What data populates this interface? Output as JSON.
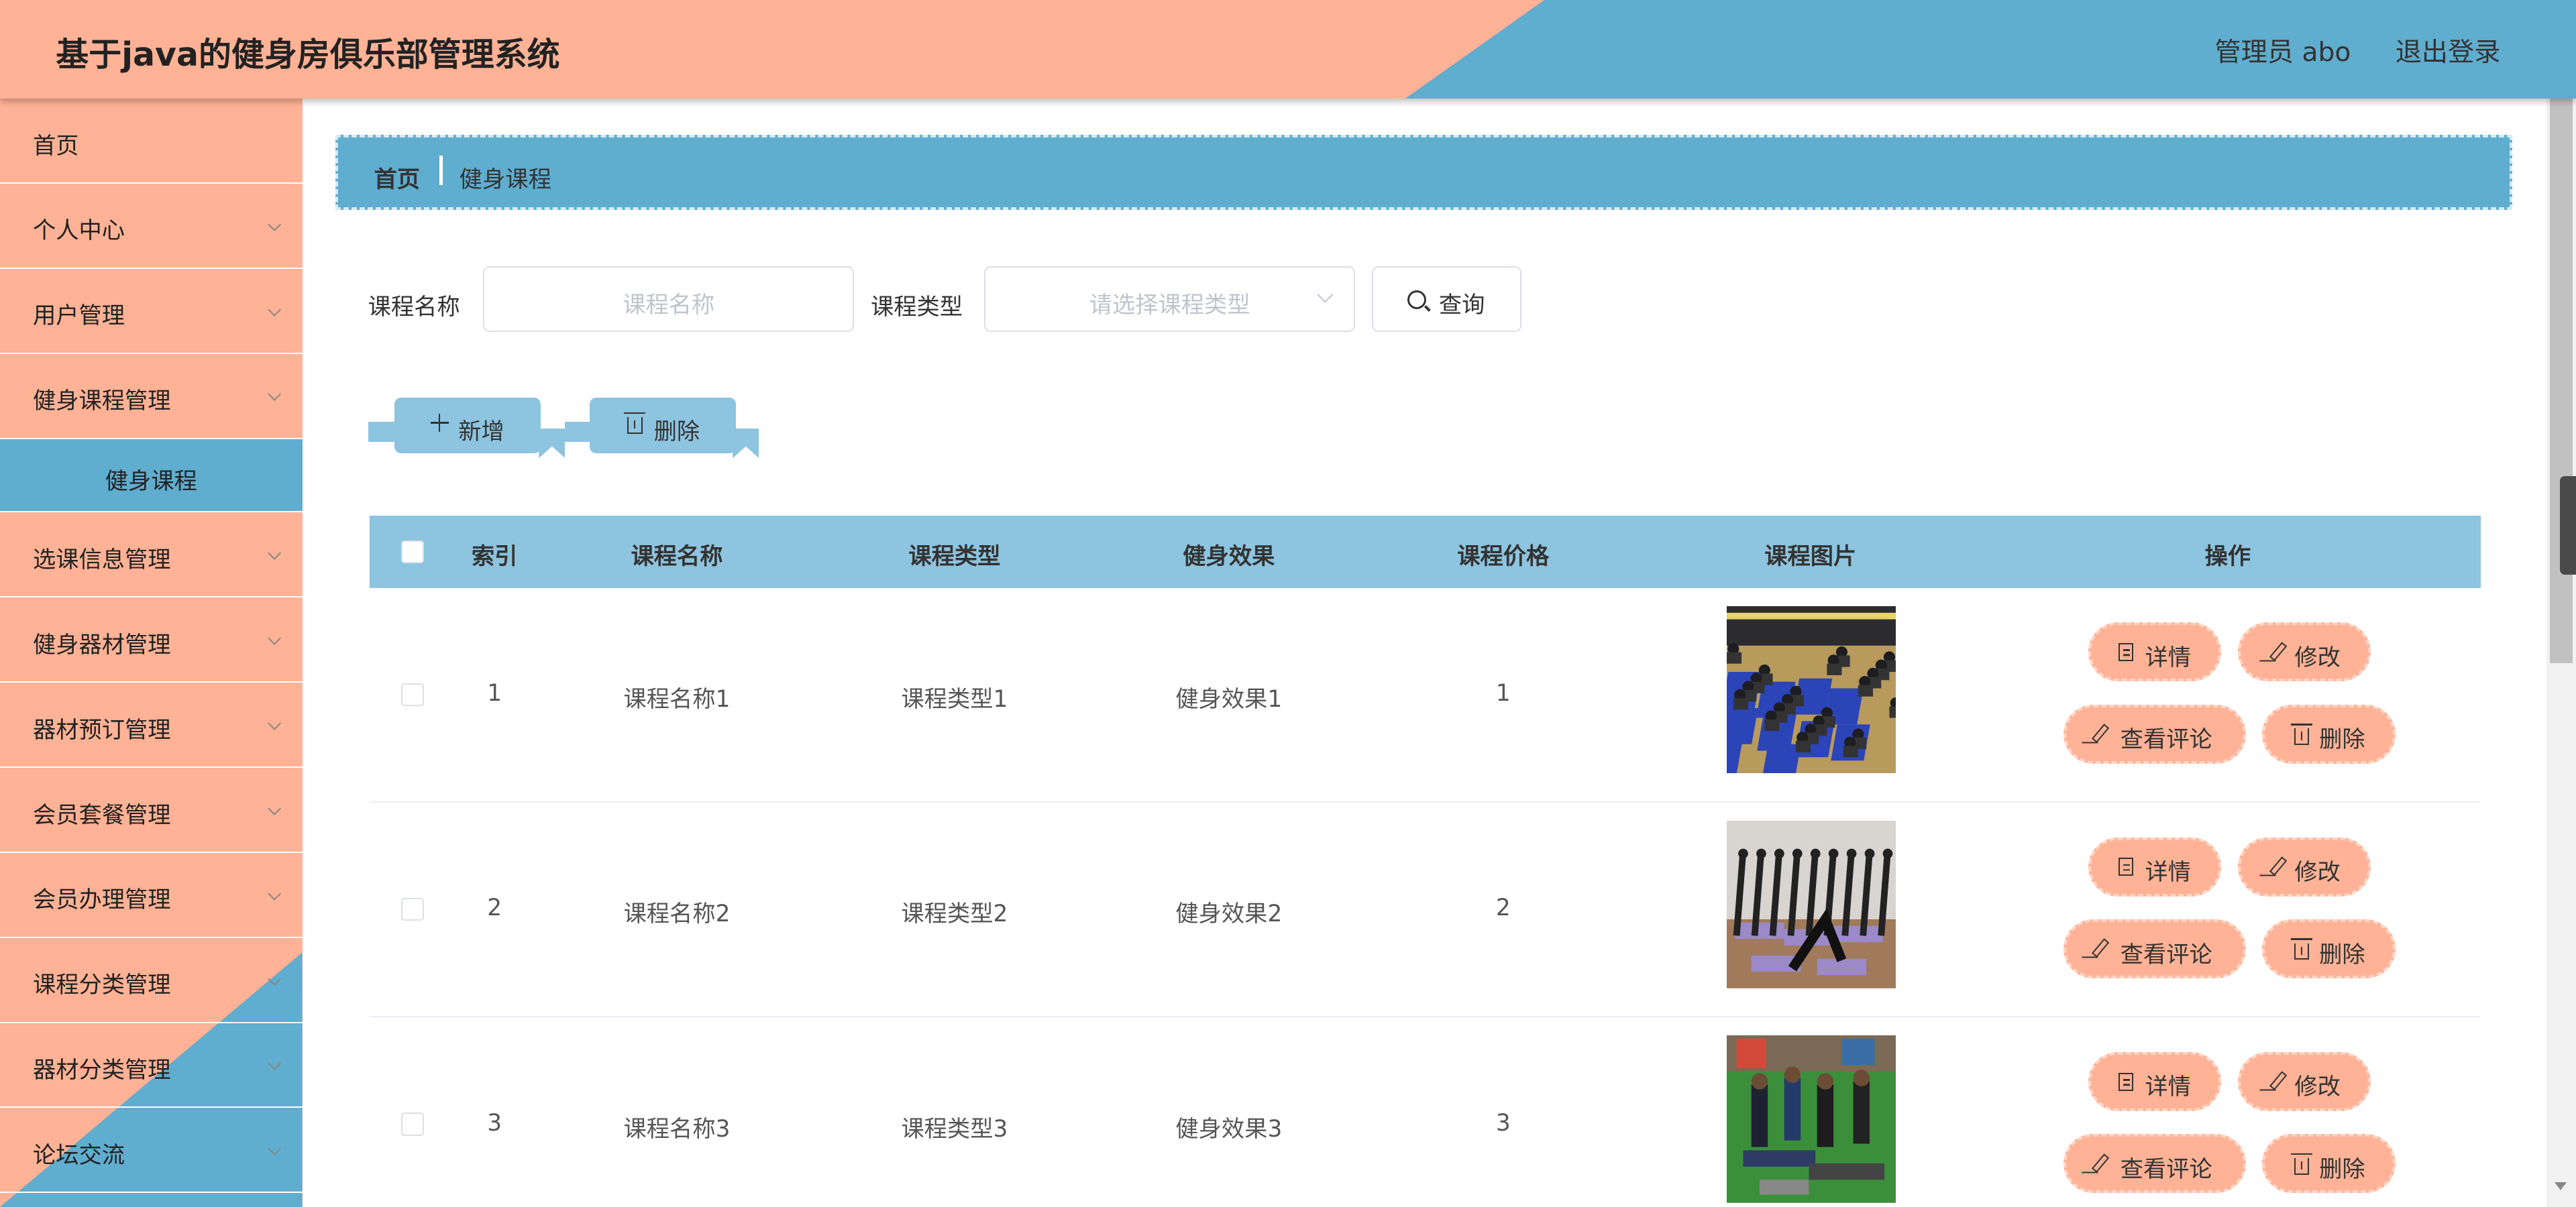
{
  "header": {
    "title": "基于java的健身房俱乐部管理系统",
    "user": "管理员 abo",
    "logout": "退出登录"
  },
  "sidebar": {
    "items": [
      {
        "label": "首页",
        "has_children": false
      },
      {
        "label": "个人中心",
        "has_children": true
      },
      {
        "label": "用户管理",
        "has_children": true
      },
      {
        "label": "健身课程管理",
        "has_children": true,
        "expanded": true
      },
      {
        "label": "健身课程",
        "is_sub": true,
        "active": true
      },
      {
        "label": "选课信息管理",
        "has_children": true
      },
      {
        "label": "健身器材管理",
        "has_children": true
      },
      {
        "label": "器材预订管理",
        "has_children": true
      },
      {
        "label": "会员套餐管理",
        "has_children": true
      },
      {
        "label": "会员办理管理",
        "has_children": true
      },
      {
        "label": "课程分类管理",
        "has_children": true
      },
      {
        "label": "器材分类管理",
        "has_children": true
      },
      {
        "label": "论坛交流",
        "has_children": true
      }
    ]
  },
  "breadcrumb": {
    "home": "首页",
    "current": "健身课程"
  },
  "search": {
    "course_name_label": "课程名称",
    "course_name_placeholder": "课程名称",
    "course_type_label": "课程类型",
    "course_type_placeholder": "请选择课程类型",
    "query_button": "查询"
  },
  "toolbar": {
    "add_button": "新增",
    "delete_button": "删除"
  },
  "table": {
    "columns": [
      "索引",
      "课程名称",
      "课程类型",
      "健身效果",
      "课程价格",
      "课程图片",
      "操作"
    ],
    "rows": [
      {
        "index": "1",
        "name": "课程名称1",
        "type": "课程类型1",
        "effect": "健身效果1",
        "price": "1",
        "image": "yoga-class-group"
      },
      {
        "index": "2",
        "name": "课程名称2",
        "type": "课程类型2",
        "effect": "健身效果2",
        "price": "2",
        "image": "yoga-stretch-group"
      },
      {
        "index": "3",
        "name": "课程名称3",
        "type": "课程类型3",
        "effect": "健身效果3",
        "price": "3",
        "image": "partner-stretch-class"
      }
    ],
    "actions": {
      "detail": "详情",
      "edit": "修改",
      "comments": "查看评论",
      "delete": "删除"
    }
  },
  "colors": {
    "salmon": "#ffb295",
    "blue": "#5fadcf",
    "light_blue": "#8dc4df"
  }
}
